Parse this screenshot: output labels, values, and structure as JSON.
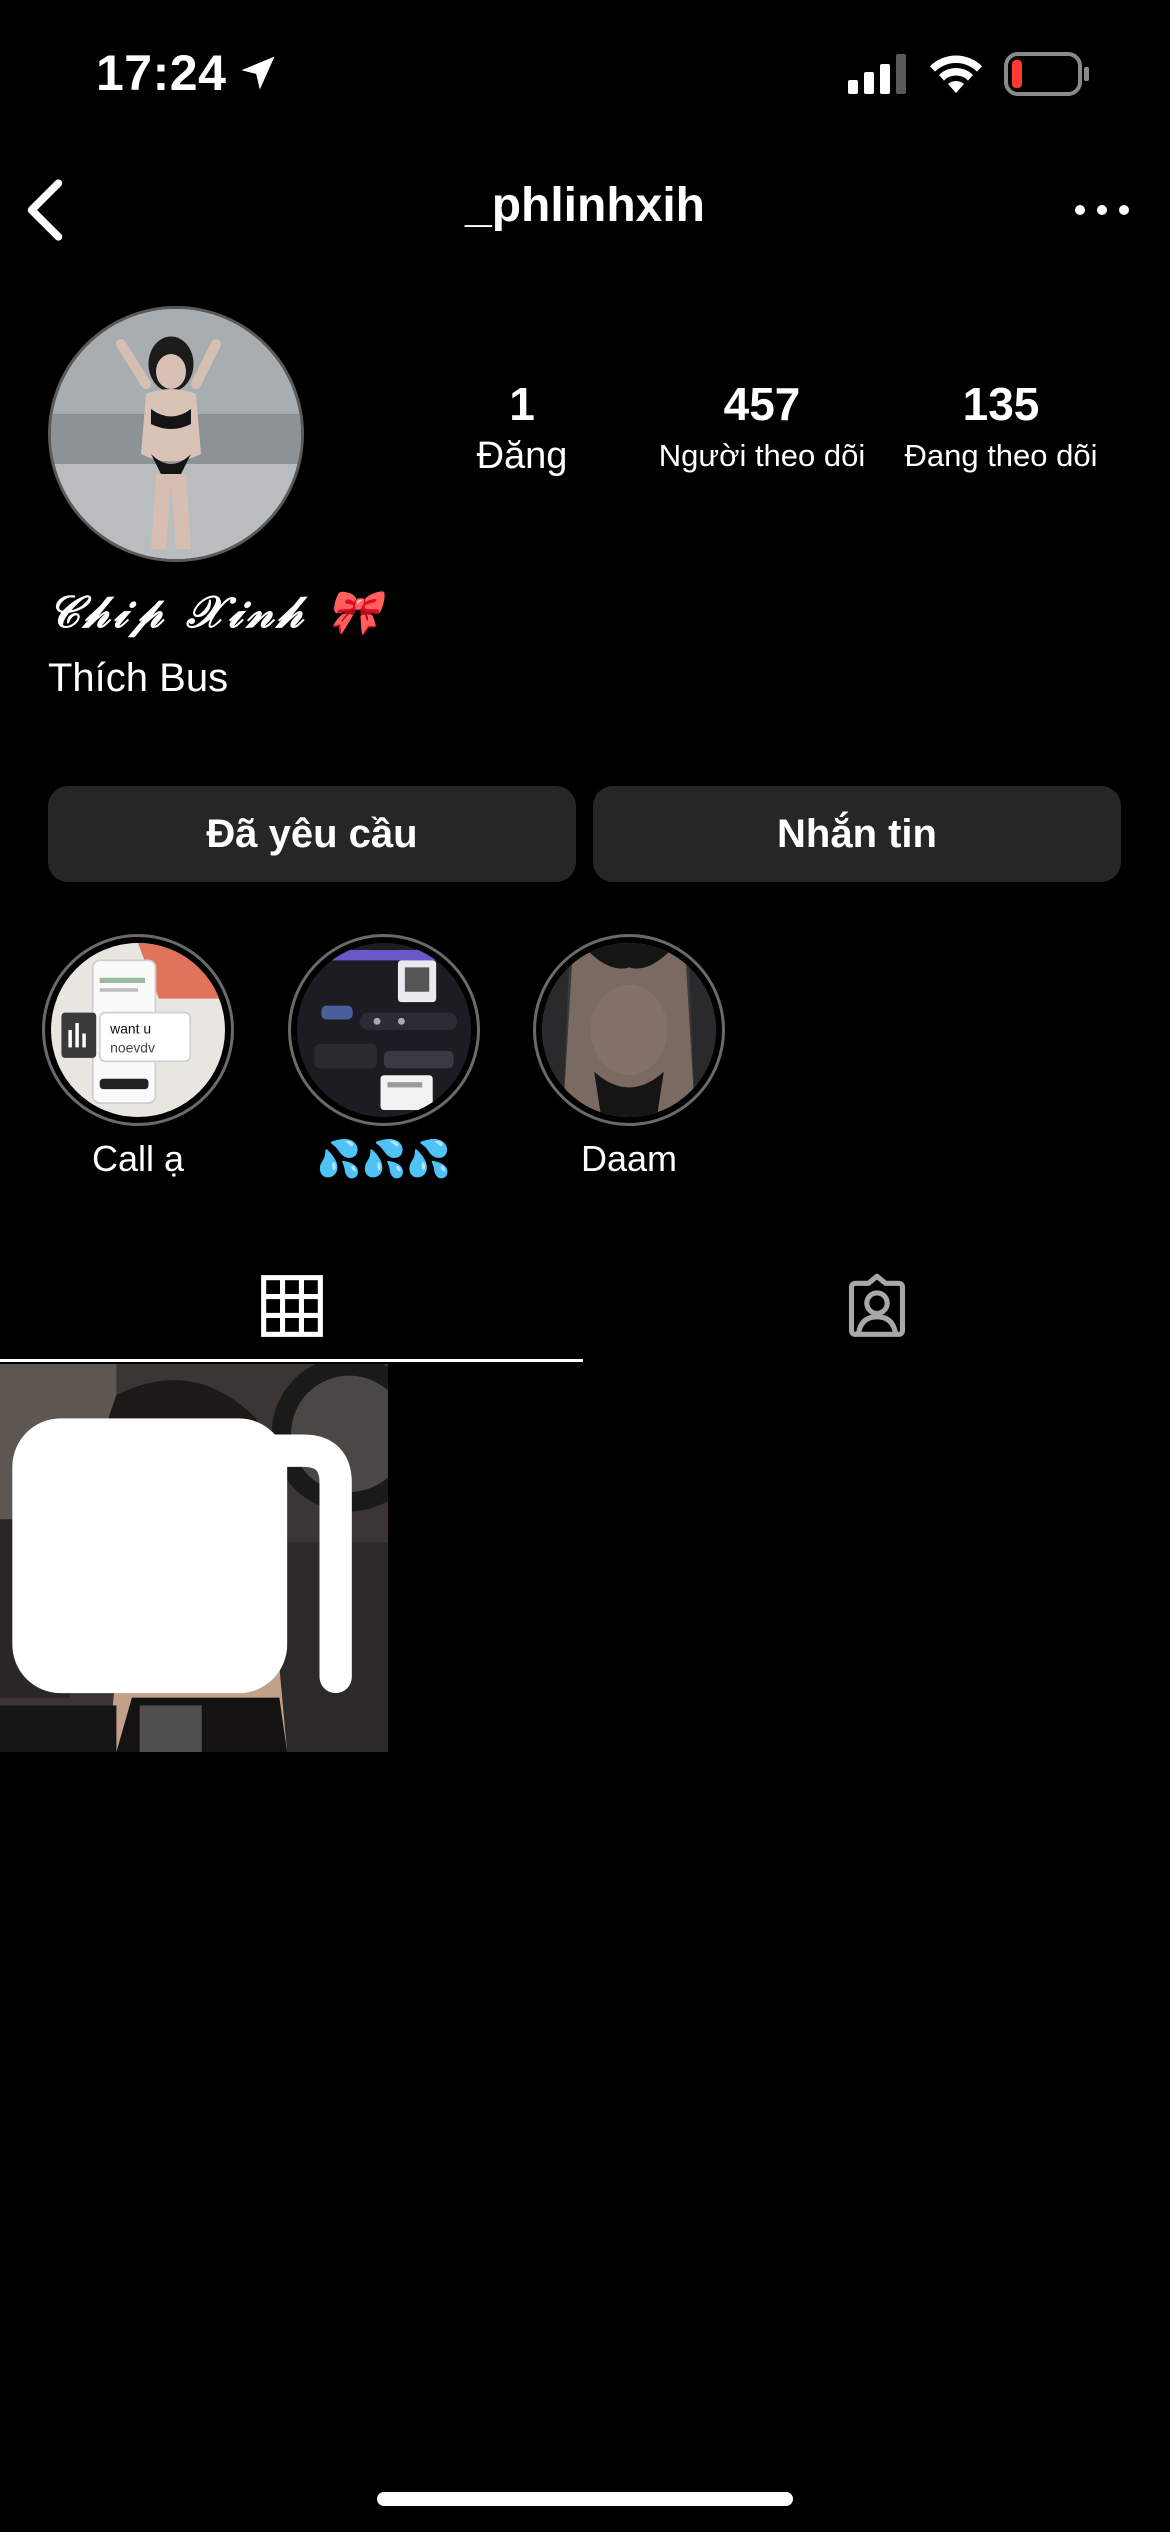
{
  "status_bar": {
    "time": "17:24",
    "location_icon": "location-arrow-icon",
    "signal_icon": "cellular-signal-icon",
    "wifi_icon": "wifi-icon",
    "battery_icon": "battery-low-icon",
    "battery_color": "#ff3b30"
  },
  "header": {
    "username": "_phlinhxih",
    "back_icon": "chevron-left-icon",
    "more_icon": "more-horizontal-icon"
  },
  "profile": {
    "display_name": "𝒞𝒽𝒾𝓅 𝒳𝒾𝓃𝒽 🎀",
    "bio": "Thích Bus",
    "stats": {
      "posts_value": "1",
      "posts_label": "Đăng",
      "followers_value": "457",
      "followers_label": "Người theo dõi",
      "following_value": "135",
      "following_label": "Đang theo dõi"
    }
  },
  "buttons": {
    "requested_label": "Đã yêu cầu",
    "message_label": "Nhắn tin"
  },
  "highlights": [
    {
      "label": "Call ạ",
      "thumb_text_1": "want u",
      "thumb_text_2": "noevdv"
    },
    {
      "label": "💦💦💦"
    },
    {
      "label": "Daam"
    }
  ],
  "tabs": {
    "grid_icon": "grid-icon",
    "tagged_icon": "tagged-person-icon",
    "active": "grid"
  },
  "colors": {
    "background": "#000000",
    "button_bg": "#262626",
    "text": "#ffffff"
  }
}
